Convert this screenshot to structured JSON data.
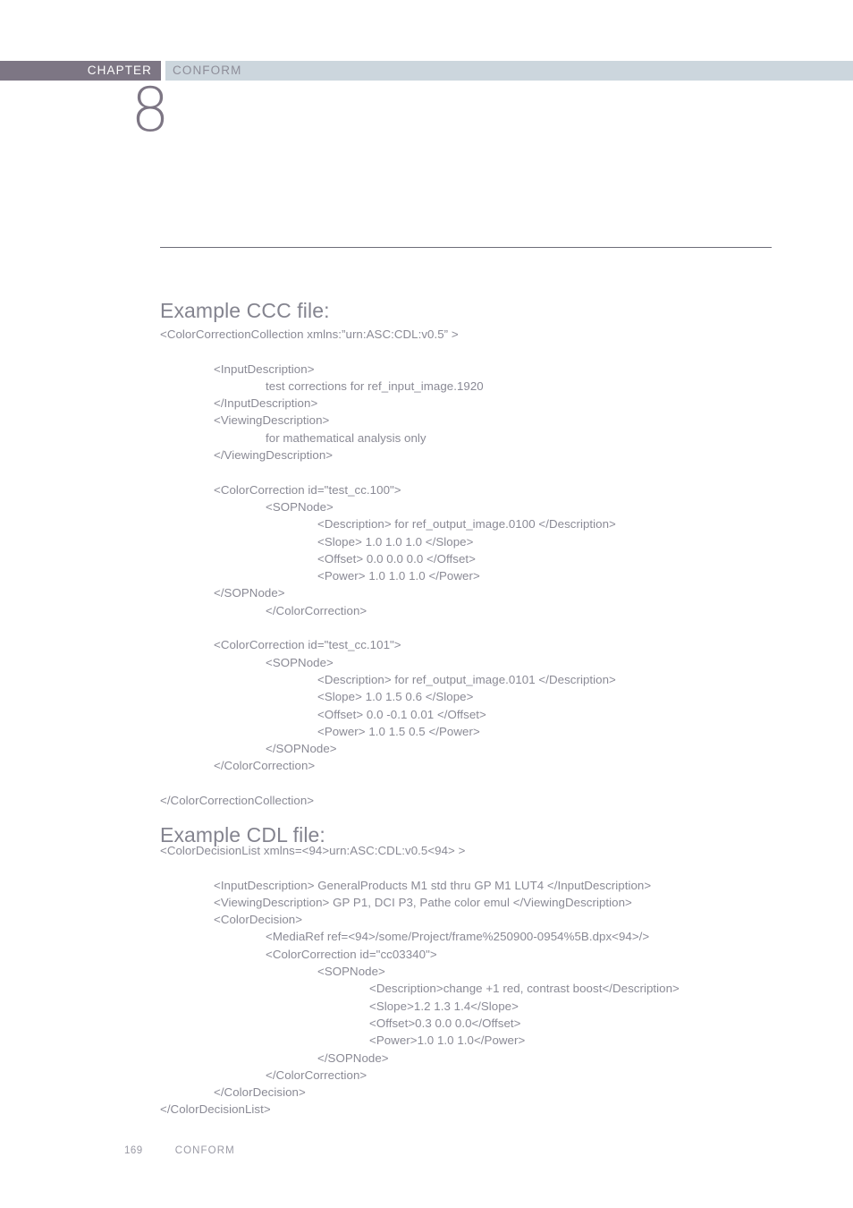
{
  "header": {
    "chapter_label": "CHAPTER",
    "section_label": "CONFORM",
    "chapter_number": "8",
    "chapter_tab_color": "#7d7684",
    "section_tab_color": "#ccd6dd"
  },
  "sections": {
    "ccc": {
      "heading": "Example CCC file:",
      "lines": [
        {
          "indent": 0,
          "text": "<ColorCorrectionCollection xmlns:”urn:ASC:CDL:v0.5” >"
        },
        {
          "indent": 0,
          "text": ""
        },
        {
          "indent": 1,
          "text": "<InputDescription>"
        },
        {
          "indent": 2,
          "text": "test corrections for ref_input_image.1920"
        },
        {
          "indent": 1,
          "text": "</InputDescription>"
        },
        {
          "indent": 1,
          "text": "<ViewingDescription>"
        },
        {
          "indent": 2,
          "text": "for mathematical analysis only"
        },
        {
          "indent": 1,
          "text": "</ViewingDescription>"
        },
        {
          "indent": 0,
          "text": ""
        },
        {
          "indent": 1,
          "text": "<ColorCorrection id=\"test_cc.100\">"
        },
        {
          "indent": 2,
          "text": "<SOPNode>"
        },
        {
          "indent": 3,
          "text": "<Description> for ref_output_image.0100 </Description>"
        },
        {
          "indent": 3,
          "text": "<Slope> 1.0 1.0 1.0 </Slope>"
        },
        {
          "indent": 3,
          "text": "<Offset> 0.0 0.0 0.0 </Offset>"
        },
        {
          "indent": 3,
          "text": "<Power> 1.0 1.0 1.0 </Power>"
        },
        {
          "indent": 1,
          "text": "</SOPNode>"
        },
        {
          "indent": 2,
          "text": "</ColorCorrection>"
        },
        {
          "indent": 0,
          "text": ""
        },
        {
          "indent": 1,
          "text": "<ColorCorrection id=\"test_cc.101\">"
        },
        {
          "indent": 2,
          "text": "<SOPNode>"
        },
        {
          "indent": 3,
          "text": "<Description> for ref_output_image.0101 </Description>"
        },
        {
          "indent": 3,
          "text": "<Slope> 1.0 1.5 0.6 </Slope>"
        },
        {
          "indent": 3,
          "text": "<Offset> 0.0 -0.1 0.01 </Offset>"
        },
        {
          "indent": 3,
          "text": "<Power> 1.0 1.5 0.5 </Power>"
        },
        {
          "indent": 2,
          "text": "</SOPNode>"
        },
        {
          "indent": 1,
          "text": "</ColorCorrection>"
        },
        {
          "indent": 0,
          "text": ""
        },
        {
          "indent": 0,
          "text": "</ColorCorrectionCollection>"
        }
      ]
    },
    "cdl": {
      "heading": "Example CDL file:",
      "lines": [
        {
          "indent": 0,
          "text": "<ColorDecisionList xmlns=<94>urn:ASC:CDL:v0.5<94> >"
        },
        {
          "indent": 0,
          "text": ""
        },
        {
          "indent": 1,
          "text": "<InputDescription> GeneralProducts M1 std thru GP M1 LUT4 </InputDescription>"
        },
        {
          "indent": 1,
          "text": "<ViewingDescription> GP P1, DCI P3, Pathe color emul </ViewingDescription>"
        },
        {
          "indent": 1,
          "text": "<ColorDecision>"
        },
        {
          "indent": 2,
          "text": "<MediaRef ref=<94>/some/Project/frame%250900-0954%5B.dpx<94>/>"
        },
        {
          "indent": 2,
          "text": "<ColorCorrection id=\"cc03340\">"
        },
        {
          "indent": 3,
          "text": "<SOPNode>"
        },
        {
          "indent": 4,
          "text": "<Description>change +1 red, contrast boost</Description>"
        },
        {
          "indent": 4,
          "text": "<Slope>1.2 1.3 1.4</Slope>"
        },
        {
          "indent": 4,
          "text": "<Offset>0.3 0.0 0.0</Offset>"
        },
        {
          "indent": 4,
          "text": "<Power>1.0 1.0 1.0</Power>"
        },
        {
          "indent": 3,
          "text": "</SOPNode>"
        },
        {
          "indent": 2,
          "text": "</ColorCorrection>"
        },
        {
          "indent": 1,
          "text": "</ColorDecision>"
        },
        {
          "indent": 0,
          "text": "</ColorDecisionList>"
        }
      ]
    }
  },
  "footer": {
    "page_number": "169",
    "section_name": "CONFORM"
  }
}
